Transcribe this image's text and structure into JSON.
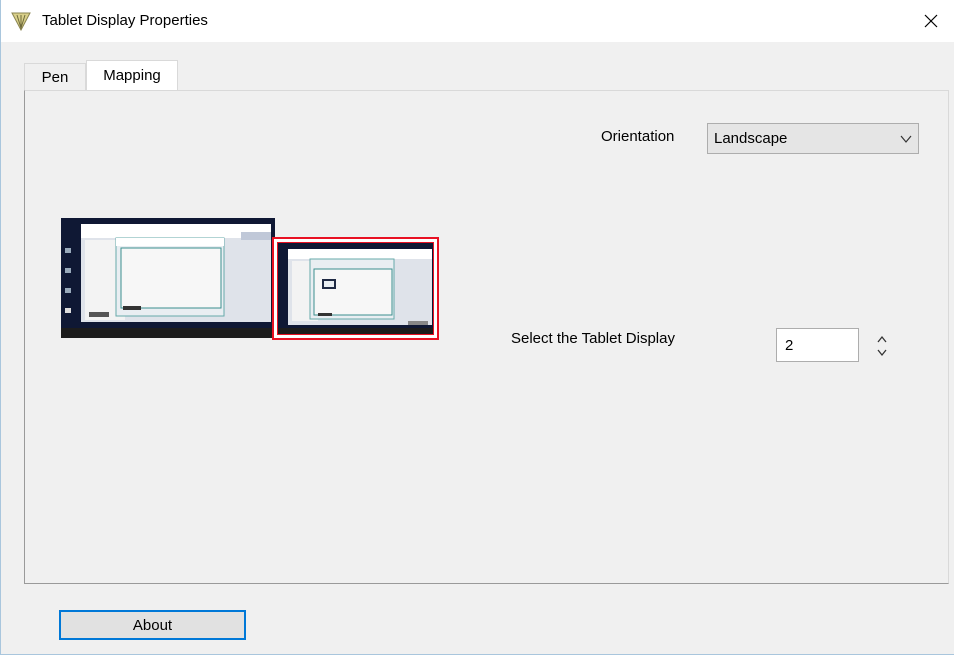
{
  "window": {
    "title": "Tablet Display Properties",
    "accent_color": "#0078d7",
    "highlight_color": "#e81123"
  },
  "tabs": [
    {
      "label": "Pen",
      "selected": false
    },
    {
      "label": "Mapping",
      "selected": true
    }
  ],
  "mapping": {
    "orientation_label": "Orientation",
    "orientation_value": "Landscape",
    "select_display_label": "Select the Tablet Display",
    "display_value": "2",
    "monitors": [
      {
        "index": 1,
        "selected": false
      },
      {
        "index": 2,
        "selected": true
      }
    ]
  },
  "footer": {
    "about_label": "About"
  },
  "icons": {
    "app": "tablet-pen-icon",
    "close": "close-icon",
    "dropdown": "chevron-down-icon",
    "spin_up": "chevron-up-icon",
    "spin_down": "chevron-down-icon"
  }
}
